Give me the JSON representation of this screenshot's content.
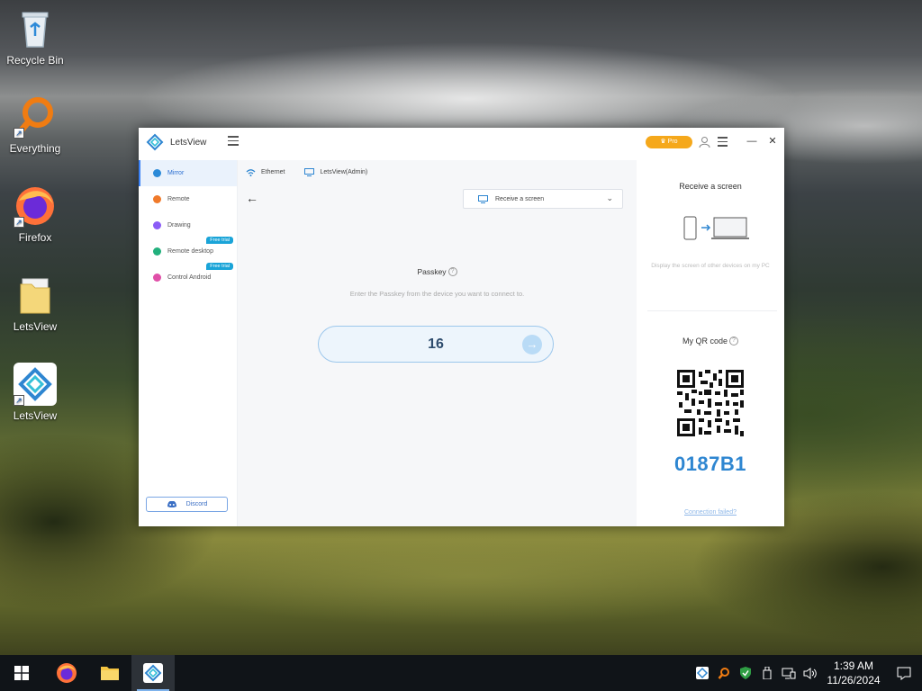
{
  "desktop": {
    "icons": [
      {
        "label": "Recycle Bin"
      },
      {
        "label": "Everything"
      },
      {
        "label": "Firefox"
      },
      {
        "label": "LetsView"
      },
      {
        "label": "LetsView"
      }
    ]
  },
  "window": {
    "app_name": "LetsView",
    "pro_label": "Pro",
    "sidebar": {
      "items": [
        {
          "label": "Mirror",
          "color": "#2b8ad8"
        },
        {
          "label": "Remote",
          "color": "#f07a2a"
        },
        {
          "label": "Drawing",
          "color": "#8b5cf6"
        },
        {
          "label": "Remote desktop",
          "color": "#22b07d",
          "badge": "Free trial"
        },
        {
          "label": "Control Android",
          "color": "#e04fa8",
          "badge": "Free trial"
        }
      ],
      "discord_label": "Discord"
    },
    "main": {
      "network_label": "Ethernet",
      "device_label": "LetsView(Admin)",
      "receive_select": "Receive a screen",
      "passkey_title": "Passkey",
      "passkey_help": "?",
      "passkey_desc": "Enter the Passkey from the device you want to connect to.",
      "passkey_value": "16"
    },
    "right": {
      "receive_title": "Receive a screen",
      "receive_desc": "Display the screen of other devices on my PC",
      "qr_title": "My QR code",
      "qr_help": "?",
      "code": "0187B1",
      "conn_link": "Connection failed?"
    }
  },
  "taskbar": {
    "time": "1:39 AM",
    "date": "11/26/2024"
  },
  "colors": {
    "accent": "#2e86d1",
    "pro": "#f5a81b",
    "badge": "#1aa4d8"
  }
}
